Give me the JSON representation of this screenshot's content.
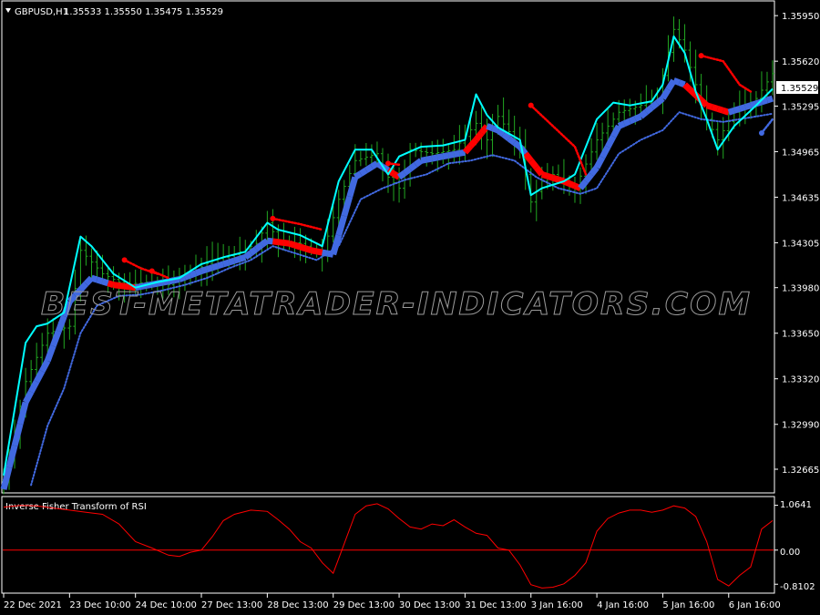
{
  "header": {
    "symbol": "GBPUSD,H1",
    "ohlc": "1.35533 1.35550 1.35475 1.35529"
  },
  "watermark": "BEST-METATRADER-INDICATORS.COM",
  "current_price_label": "1.35529",
  "indicator": {
    "title": "Inverse Fisher Transform of RSI",
    "levels": [
      "1.0641",
      "0.00",
      "-0.8102"
    ]
  },
  "colors": {
    "background": "#000000",
    "candles": "#22a822",
    "upper_band": "#00ffff",
    "trend_up": "#4169e1",
    "trend_down": "#ff0000",
    "ifish_line": "#ff0000",
    "axis": "#ffffff"
  },
  "chart_data": [
    {
      "type": "line",
      "title": "GBPUSD,H1",
      "ylim": [
        1.325,
        1.3605
      ],
      "y_ticks": [
        1.3595,
        1.3562,
        1.35295,
        1.34965,
        1.34635,
        1.34305,
        1.3398,
        1.3365,
        1.3332,
        1.3299,
        1.32665
      ],
      "y_tick_labels": [
        "1.35950",
        "1.35620",
        "1.35295",
        "1.34965",
        "1.34635",
        "1.34305",
        "1.33980",
        "1.33650",
        "1.33320",
        "1.32990",
        "1.32665"
      ],
      "x_ticks": [
        "22 Dec 2021",
        "23 Dec 10:00",
        "24 Dec 10:00",
        "27 Dec 13:00",
        "28 Dec 13:00",
        "29 Dec 13:00",
        "30 Dec 13:00",
        "31 Dec 13:00",
        "3 Jan 16:00",
        "4 Jan 16:00",
        "5 Jan 16:00",
        "6 Jan 16:00"
      ],
      "x_tick_index": [
        0,
        12,
        24,
        36,
        48,
        60,
        72,
        84,
        96,
        108,
        120,
        132
      ],
      "bars": 141,
      "close_anchors": [
        [
          0,
          1.3258
        ],
        [
          4,
          1.333
        ],
        [
          8,
          1.3365
        ],
        [
          12,
          1.337
        ],
        [
          14,
          1.3425
        ],
        [
          18,
          1.3408
        ],
        [
          22,
          1.34
        ],
        [
          26,
          1.3402
        ],
        [
          30,
          1.34
        ],
        [
          34,
          1.3408
        ],
        [
          38,
          1.3418
        ],
        [
          42,
          1.3422
        ],
        [
          46,
          1.343
        ],
        [
          48,
          1.3445
        ],
        [
          50,
          1.3432
        ],
        [
          54,
          1.343
        ],
        [
          58,
          1.3422
        ],
        [
          61,
          1.3462
        ],
        [
          64,
          1.349
        ],
        [
          68,
          1.3495
        ],
        [
          70,
          1.3478
        ],
        [
          72,
          1.347
        ],
        [
          74,
          1.3498
        ],
        [
          78,
          1.3495
        ],
        [
          82,
          1.3498
        ],
        [
          86,
          1.3517
        ],
        [
          88,
          1.3505
        ],
        [
          90,
          1.3522
        ],
        [
          94,
          1.35
        ],
        [
          96,
          1.346
        ],
        [
          98,
          1.3475
        ],
        [
          100,
          1.348
        ],
        [
          104,
          1.347
        ],
        [
          108,
          1.3505
        ],
        [
          112,
          1.3525
        ],
        [
          116,
          1.353
        ],
        [
          119,
          1.3535
        ],
        [
          122,
          1.3585
        ],
        [
          124,
          1.357
        ],
        [
          128,
          1.352
        ],
        [
          130,
          1.3505
        ],
        [
          133,
          1.3525
        ],
        [
          137,
          1.3535
        ],
        [
          140,
          1.3553
        ]
      ],
      "series": [
        {
          "name": "",
          "role": "upper band",
          "values": [
            [
              0,
              1.3262
            ],
            [
              2,
              1.331
            ],
            [
              4,
              1.3358
            ],
            [
              6,
              1.337
            ],
            [
              8,
              1.3372
            ],
            [
              11,
              1.338
            ],
            [
              14,
              1.3435
            ],
            [
              16,
              1.3428
            ],
            [
              20,
              1.3408
            ],
            [
              24,
              1.3398
            ],
            [
              28,
              1.3402
            ],
            [
              32,
              1.3405
            ],
            [
              36,
              1.3415
            ],
            [
              40,
              1.342
            ],
            [
              44,
              1.3424
            ],
            [
              48,
              1.3445
            ],
            [
              50,
              1.344
            ],
            [
              54,
              1.3436
            ],
            [
              58,
              1.3428
            ],
            [
              61,
              1.3475
            ],
            [
              64,
              1.3498
            ],
            [
              67,
              1.3498
            ],
            [
              70,
              1.348
            ],
            [
              72,
              1.3493
            ],
            [
              76,
              1.35
            ],
            [
              80,
              1.3501
            ],
            [
              84,
              1.3505
            ],
            [
              86,
              1.3538
            ],
            [
              88,
              1.3523
            ],
            [
              90,
              1.3514
            ],
            [
              94,
              1.3505
            ],
            [
              96,
              1.3465
            ],
            [
              98,
              1.347
            ],
            [
              102,
              1.3475
            ],
            [
              104,
              1.348
            ],
            [
              108,
              1.352
            ],
            [
              111,
              1.3532
            ],
            [
              114,
              1.353
            ],
            [
              118,
              1.3533
            ],
            [
              120,
              1.3545
            ],
            [
              122,
              1.358
            ],
            [
              124,
              1.3568
            ],
            [
              126,
              1.354
            ],
            [
              128,
              1.352
            ],
            [
              130,
              1.3498
            ],
            [
              133,
              1.3515
            ],
            [
              137,
              1.353
            ],
            [
              140,
              1.3542
            ]
          ]
        },
        {
          "name": "",
          "role": "trend line",
          "values": [
            [
              0,
              1.3252
            ],
            [
              4,
              1.3315
            ],
            [
              8,
              1.3345
            ],
            [
              12,
              1.3388
            ],
            [
              16,
              1.3405
            ],
            [
              20,
              1.34
            ],
            [
              24,
              1.3398
            ],
            [
              28,
              1.3401
            ],
            [
              32,
              1.3404
            ],
            [
              36,
              1.341
            ],
            [
              40,
              1.3415
            ],
            [
              44,
              1.342
            ],
            [
              48,
              1.3432
            ],
            [
              52,
              1.343
            ],
            [
              56,
              1.3425
            ],
            [
              60,
              1.3422
            ],
            [
              62,
              1.345
            ],
            [
              64,
              1.3478
            ],
            [
              68,
              1.3488
            ],
            [
              72,
              1.3478
            ],
            [
              76,
              1.349
            ],
            [
              80,
              1.3493
            ],
            [
              84,
              1.3496
            ],
            [
              86,
              1.3505
            ],
            [
              88,
              1.3515
            ],
            [
              90,
              1.3512
            ],
            [
              94,
              1.35
            ],
            [
              98,
              1.348
            ],
            [
              102,
              1.3475
            ],
            [
              105,
              1.347
            ],
            [
              108,
              1.3485
            ],
            [
              112,
              1.3515
            ],
            [
              116,
              1.3522
            ],
            [
              120,
              1.3535
            ],
            [
              122,
              1.3548
            ],
            [
              124,
              1.3545
            ],
            [
              128,
              1.353
            ],
            [
              132,
              1.3525
            ],
            [
              136,
              1.353
            ],
            [
              140,
              1.3535
            ]
          ],
          "down_segments": [
            [
              19,
              24
            ],
            [
              49,
              58
            ],
            [
              70,
              72
            ],
            [
              84,
              88
            ],
            [
              95,
              105
            ],
            [
              124,
              132
            ]
          ]
        },
        {
          "name": "",
          "role": "lower dotted band",
          "values": [
            [
              5,
              1.3255
            ],
            [
              8,
              1.3298
            ],
            [
              11,
              1.3325
            ],
            [
              14,
              1.3365
            ],
            [
              17,
              1.3385
            ],
            [
              21,
              1.3392
            ],
            [
              25,
              1.3393
            ],
            [
              29,
              1.3396
            ],
            [
              33,
              1.34
            ],
            [
              37,
              1.3405
            ],
            [
              41,
              1.3412
            ],
            [
              45,
              1.3418
            ],
            [
              49,
              1.3428
            ],
            [
              53,
              1.3423
            ],
            [
              57,
              1.3418
            ],
            [
              61,
              1.3428
            ],
            [
              65,
              1.3462
            ],
            [
              69,
              1.347
            ],
            [
              73,
              1.3476
            ],
            [
              77,
              1.348
            ],
            [
              81,
              1.3488
            ],
            [
              85,
              1.349
            ],
            [
              89,
              1.3494
            ],
            [
              93,
              1.349
            ],
            [
              97,
              1.3478
            ],
            [
              101,
              1.347
            ],
            [
              105,
              1.3466
            ],
            [
              108,
              1.347
            ],
            [
              112,
              1.3495
            ],
            [
              116,
              1.3505
            ],
            [
              120,
              1.3512
            ],
            [
              123,
              1.3525
            ],
            [
              127,
              1.352
            ],
            [
              131,
              1.3518
            ],
            [
              134,
              1.352
            ],
            [
              137,
              1.3522
            ],
            [
              140,
              1.3524
            ]
          ]
        },
        {
          "name": "",
          "role": "red dotted trail",
          "segments": [
            [
              [
                22,
                1.3418
              ],
              [
                25,
                1.3412
              ],
              [
                28,
                1.3408
              ]
            ],
            [
              [
                27,
                1.341
              ],
              [
                30,
                1.3405
              ]
            ],
            [
              [
                49,
                1.3448
              ],
              [
                54,
                1.3444
              ],
              [
                58,
                1.344
              ]
            ],
            [
              [
                70,
                1.3488
              ],
              [
                72,
                1.3487
              ]
            ],
            [
              [
                96,
                1.353
              ],
              [
                100,
                1.3515
              ],
              [
                104,
                1.35
              ],
              [
                106,
                1.348
              ]
            ],
            [
              [
                127,
                1.3566
              ],
              [
                131,
                1.3562
              ],
              [
                134,
                1.3545
              ],
              [
                136,
                1.354
              ]
            ]
          ]
        },
        {
          "name": "",
          "role": "blue dotted trail",
          "segments": [
            [
              [
                138,
                1.351
              ],
              [
                140,
                1.352
              ]
            ]
          ]
        }
      ]
    },
    {
      "type": "line",
      "title": "Inverse Fisher Transform of RSI",
      "ylim": [
        -1.0,
        1.25
      ],
      "y_ticks": [
        1.0641,
        0.0,
        -0.8102
      ],
      "series": [
        {
          "name": "",
          "values": [
            [
              0,
              1.02
            ],
            [
              3,
              1.06
            ],
            [
              6,
              1.05
            ],
            [
              9,
              1.0
            ],
            [
              12,
              0.95
            ],
            [
              15,
              0.9
            ],
            [
              18,
              0.85
            ],
            [
              21,
              0.62
            ],
            [
              24,
              0.2
            ],
            [
              27,
              0.05
            ],
            [
              30,
              -0.12
            ],
            [
              32,
              -0.15
            ],
            [
              34,
              -0.05
            ],
            [
              36,
              0.0
            ],
            [
              38,
              0.32
            ],
            [
              40,
              0.7
            ],
            [
              42,
              0.85
            ],
            [
              45,
              0.95
            ],
            [
              48,
              0.92
            ],
            [
              50,
              0.72
            ],
            [
              52,
              0.5
            ],
            [
              54,
              0.2
            ],
            [
              56,
              0.05
            ],
            [
              58,
              -0.3
            ],
            [
              60,
              -0.55
            ],
            [
              62,
              0.15
            ],
            [
              64,
              0.85
            ],
            [
              66,
              1.05
            ],
            [
              68,
              1.1
            ],
            [
              70,
              0.98
            ],
            [
              72,
              0.75
            ],
            [
              74,
              0.55
            ],
            [
              76,
              0.5
            ],
            [
              78,
              0.62
            ],
            [
              80,
              0.58
            ],
            [
              82,
              0.72
            ],
            [
              84,
              0.55
            ],
            [
              86,
              0.4
            ],
            [
              88,
              0.35
            ],
            [
              90,
              0.05
            ],
            [
              92,
              0.0
            ],
            [
              94,
              -0.35
            ],
            [
              96,
              -0.82
            ],
            [
              98,
              -0.9
            ],
            [
              100,
              -0.88
            ],
            [
              102,
              -0.8
            ],
            [
              104,
              -0.6
            ],
            [
              106,
              -0.3
            ],
            [
              108,
              0.45
            ],
            [
              110,
              0.75
            ],
            [
              112,
              0.88
            ],
            [
              114,
              0.95
            ],
            [
              116,
              0.95
            ],
            [
              118,
              0.9
            ],
            [
              120,
              0.95
            ],
            [
              122,
              1.05
            ],
            [
              124,
              1.0
            ],
            [
              126,
              0.8
            ],
            [
              128,
              0.2
            ],
            [
              130,
              -0.7
            ],
            [
              132,
              -0.85
            ],
            [
              134,
              -0.6
            ],
            [
              136,
              -0.4
            ],
            [
              138,
              0.5
            ],
            [
              140,
              0.7
            ]
          ]
        }
      ]
    }
  ]
}
